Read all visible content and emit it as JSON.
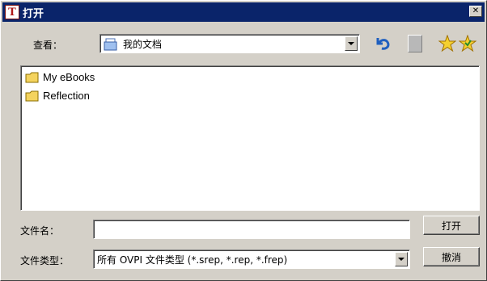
{
  "window": {
    "title": "打开",
    "app_icon_glyph": "T"
  },
  "lookin": {
    "label": "查看：",
    "value": "我的文档"
  },
  "files": [
    {
      "name": "My eBooks"
    },
    {
      "name": "Reflection"
    }
  ],
  "filename": {
    "label": "文件名：",
    "value": ""
  },
  "filetype": {
    "label": "文件类型：",
    "value": "所有 OVPI 文件类型 (*.srep, *.rep, *.frep)"
  },
  "buttons": {
    "open": "打开",
    "cancel": "撤消"
  },
  "colors": {
    "titlebar": "#0a246a",
    "dialog_bg": "#d4d0c8",
    "folder": "#f4d35e"
  }
}
